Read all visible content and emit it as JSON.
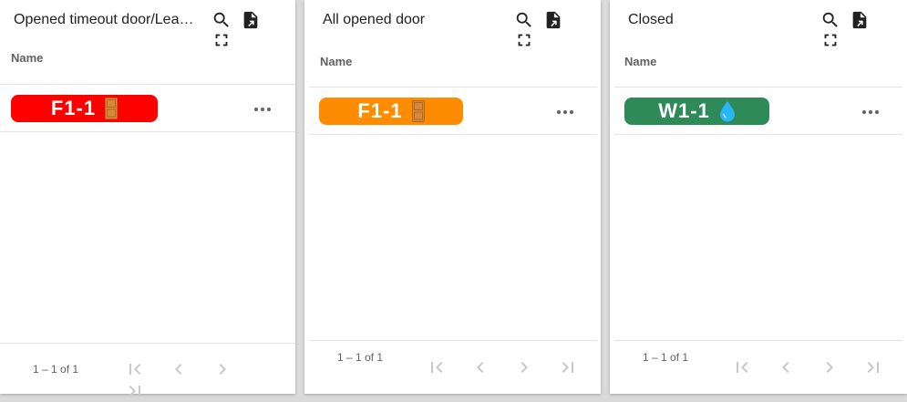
{
  "panels": [
    {
      "title": "Opened timeout door/Leakage",
      "column_header": "Name",
      "row": {
        "label": "F1-1",
        "color": "#ff0000",
        "icon": "door-icon"
      },
      "pagination": {
        "range": "1 – 1 of 1"
      }
    },
    {
      "title": "All opened door",
      "column_header": "Name",
      "row": {
        "label": "F1-1",
        "color": "#ff8c00",
        "icon": "door-icon"
      },
      "pagination": {
        "range": "1 – 1 of 1"
      }
    },
    {
      "title": "Closed",
      "column_header": "Name",
      "row": {
        "label": "W1-1",
        "color": "#2e8b57",
        "icon": "water-drop-icon"
      },
      "pagination": {
        "range": "1 – 1 of 1"
      }
    }
  ],
  "toolbar_icons": [
    "search-icon",
    "export-file-icon",
    "fullscreen-icon"
  ],
  "pager_icons": [
    "first-page-icon",
    "previous-page-icon",
    "next-page-icon",
    "last-page-icon"
  ]
}
